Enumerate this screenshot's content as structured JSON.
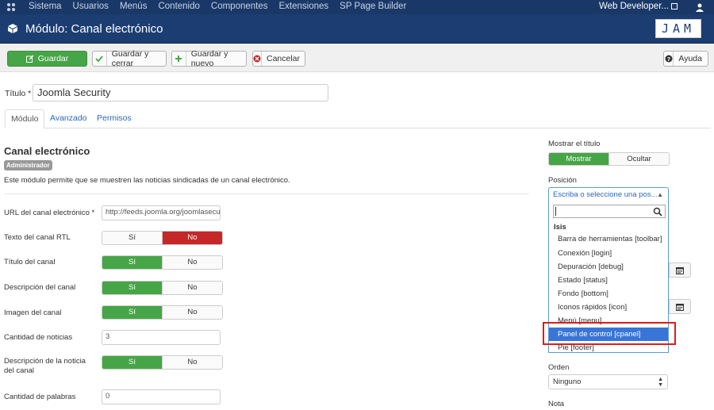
{
  "topbar": {
    "menu": [
      "Sistema",
      "Usuarios",
      "Menús",
      "Contenido",
      "Componentes",
      "Extensiones",
      "SP Page Builder"
    ],
    "user_site": "Web Developer..."
  },
  "header": {
    "title": "Módulo: Canal electrónico",
    "brand": "JAM"
  },
  "toolbar": {
    "save": "Guardar",
    "save_close": "Guardar y cerrar",
    "save_new": "Guardar y nuevo",
    "cancel": "Cancelar",
    "help": "Ayuda"
  },
  "form": {
    "title_label": "Título *",
    "title_value": "Joomla Security",
    "tabs": [
      "Módulo",
      "Avanzado",
      "Permisos"
    ],
    "section_title": "Canal electrónico",
    "badge": "Administrador",
    "description": "Este módulo permite que se muestren las noticias sindicadas de un canal electrónico.",
    "yes": "Sí",
    "no": "No",
    "fields": {
      "feed_url_label": "URL del canal electrónico *",
      "feed_url_value": "http://feeds.joomla.org/joomlasecurity",
      "rtl_label": "Texto del canal RTL",
      "feed_title_label": "Título del canal",
      "feed_desc_label": "Descripción del canal",
      "feed_image_label": "Imagen del canal",
      "news_count_label": "Cantidad de noticias",
      "news_count_value": "3",
      "news_desc_label": "Descripción de la noticia del canal",
      "word_count_label": "Cantidad de palabras",
      "word_count_value": "0"
    }
  },
  "right": {
    "show_title_label": "Mostrar el título",
    "show": "Mostrar",
    "hide": "Ocultar",
    "position_label": "Posición",
    "position_placeholder": "Escriba o seleccione una pos...",
    "dropdown_group": "Isis",
    "dropdown_items": [
      "Barra de herramientas [toolbar]",
      "Conexión [login]",
      "Depuración [debug]",
      "Estado [status]",
      "Fondo [bottom]",
      "Iconos rápidos [icon]",
      "Menú [menu]",
      "Panel de control [cpanel]",
      "Pie [footer]"
    ],
    "order_label": "Orden",
    "order_value": "Ninguno",
    "note_label": "Nota"
  },
  "colors": {
    "navbar": "#1a3867",
    "header": "#1c3d72",
    "success": "#46a546",
    "danger": "#c52827",
    "highlight": "#3875d7",
    "annotation": "#e21a1a"
  }
}
